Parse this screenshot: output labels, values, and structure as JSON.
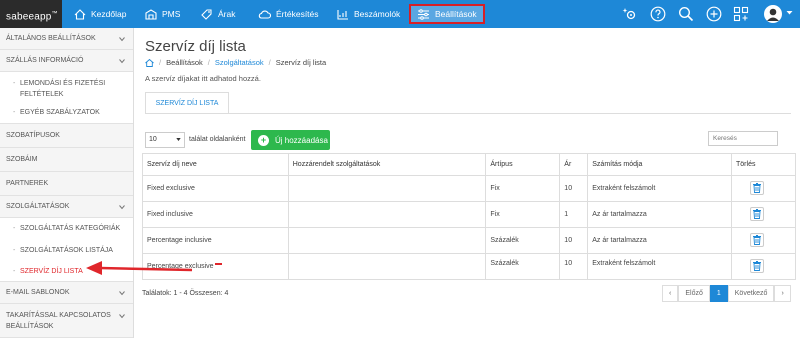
{
  "app": {
    "logo_text": "sabeeapp",
    "logo_mark": "™"
  },
  "nav": {
    "items": [
      {
        "label": "Kezdőlap",
        "icon": "home-icon"
      },
      {
        "label": "PMS",
        "icon": "building-icon"
      },
      {
        "label": "Árak",
        "icon": "tag-icon"
      },
      {
        "label": "Értékesítés",
        "icon": "cloud-icon"
      },
      {
        "label": "Beszámolók",
        "icon": "chart-icon"
      },
      {
        "label": "Beállítások",
        "icon": "sliders-icon",
        "active": true
      }
    ],
    "right_icons": [
      "settings-sparkle-icon",
      "help-icon",
      "search-icon",
      "add-icon",
      "apps-icon",
      "avatar",
      "chevron-down-icon"
    ],
    "highlight_color": "#d71f26",
    "bar_color": "#1e88d7"
  },
  "sidebar": {
    "items": [
      {
        "label": "ÁLTALÁNOS BEÁLLÍTÁSOK"
      },
      {
        "label": "SZÁLLÁS INFORMÁCIÓ"
      },
      {
        "label": "LEMONDÁSI ÉS FIZETÉSI",
        "label2": "FELTÉTELEK"
      },
      {
        "label": "EGYÉB SZABÁLYZATOK"
      },
      {
        "label": "SZOBATÍPUSOK"
      },
      {
        "label": "SZOBÁIM"
      },
      {
        "label": "PARTNEREK"
      },
      {
        "label": "SZOLGÁLTATÁSOK"
      },
      {
        "label": "SZOLGÁLTATÁS KATEGÓRIÁK"
      },
      {
        "label": "SZOLGÁLTATÁSOK LISTÁJA"
      },
      {
        "label": "SZERVÍZ DÍJ LISTA",
        "active": true
      },
      {
        "label": "E-MAIL SABLONOK"
      },
      {
        "label": "TAKARÍTÁSSAL KAPCSOLATOS",
        "label2": "BEÁLLÍTÁSOK"
      }
    ]
  },
  "main": {
    "title": "Szervíz díj lista",
    "breadcrumb": [
      "Beállítások",
      "Szolgáltatások",
      "Szervíz díj lista"
    ],
    "hint": "A szervíz díjakat itt adhatod hozzá.",
    "tab": "SZERVÍZ DÍJ LISTA",
    "per_page_value": "10",
    "per_page_label": "találat oldalanként",
    "add_button": "Új hozzáadása",
    "search_placeholder": "Keresés",
    "table": {
      "headers": [
        "Szervíz díj neve",
        "Hozzárendelt szolgáltatások",
        "Ártípus",
        "Ár",
        "Számítás módja",
        "Törlés"
      ],
      "rows": [
        [
          "Fixed exclusive",
          "",
          "Fix",
          "10",
          "Extraként felszámolt"
        ],
        [
          "Fixed inclusive",
          "",
          "Fix",
          "1",
          "Az ár tartalmazza"
        ],
        [
          "Percentage inclusive",
          "",
          "Százalék",
          "10",
          "Az ár tartalmazza"
        ],
        [
          "Percentage exclusive",
          "",
          "Százalék",
          "10",
          "Extraként felszámolt"
        ]
      ]
    },
    "found": "Találatok: 1 - 4 Összesen: 4",
    "pager": {
      "prev": "Előző",
      "current": "1",
      "next": "Következő"
    }
  }
}
